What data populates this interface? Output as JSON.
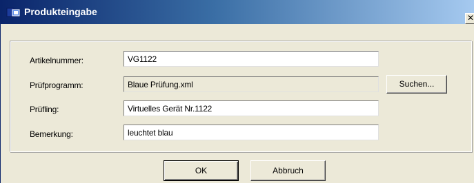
{
  "window": {
    "title": "Produkteingabe",
    "close_glyph": "✕"
  },
  "form": {
    "artikelnummer_label": "Artikelnummer:",
    "artikelnummer_value": "VG1122",
    "pruefprogramm_label": "Prüfprogramm:",
    "pruefprogramm_value": "Blaue Prüfung.xml",
    "pruefling_label": "Prüfling:",
    "pruefling_value": "Virtuelles Gerät Nr.1122",
    "bemerkung_label": "Bemerkung:",
    "bemerkung_value": "leuchtet blau"
  },
  "buttons": {
    "suchen_label": "Suchen...",
    "ok_label": "OK",
    "abbruch_label": "Abbruch"
  },
  "colors": {
    "titlebar_start": "#0a246a",
    "titlebar_end": "#a6caf0",
    "dialog_background": "#ece9d8"
  }
}
